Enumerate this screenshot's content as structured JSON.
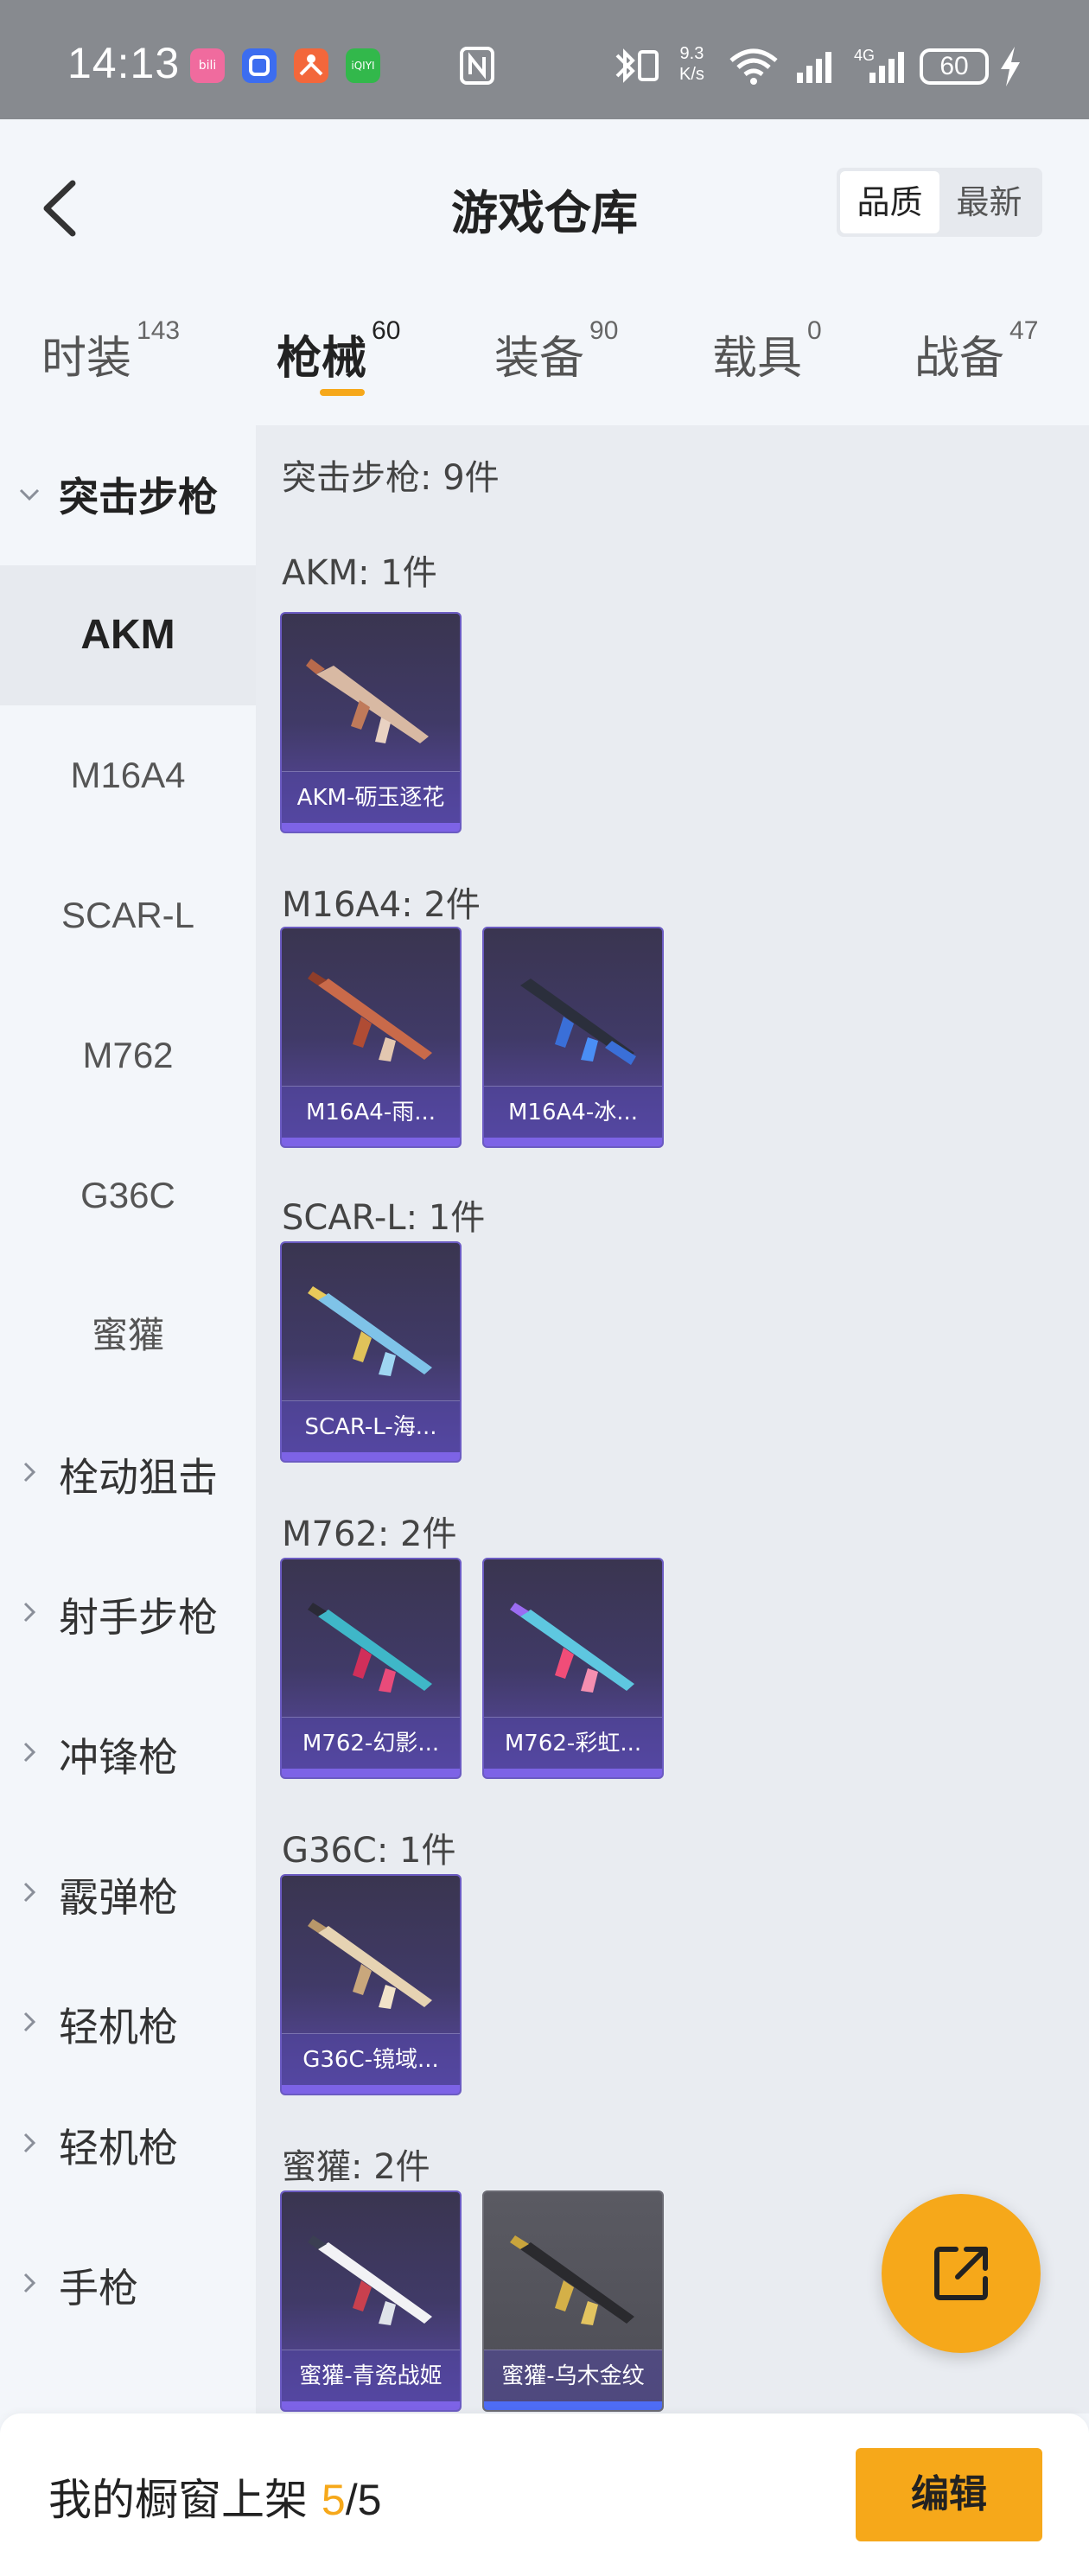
{
  "status_bar": {
    "time": "14:13",
    "apps": [
      {
        "name": "bilibili-app-icon",
        "label": "bili",
        "color": "#f06b9e"
      },
      {
        "name": "blue-app-icon",
        "label": "",
        "color": "#3c6df0"
      },
      {
        "name": "orange-app-icon",
        "label": "",
        "color": "#f3673b"
      },
      {
        "name": "iqiyi-app-icon",
        "label": "iQIYI",
        "color": "#32b84b"
      }
    ],
    "net_speed_value": "9.3",
    "net_speed_unit": "K/s",
    "battery": "60"
  },
  "header": {
    "title": "游戏仓库",
    "sort_options": [
      "品质",
      "最新"
    ],
    "active_sort": "品质"
  },
  "tabs": [
    {
      "label": "时装",
      "count": "143"
    },
    {
      "label": "枪械",
      "count": "60"
    },
    {
      "label": "装备",
      "count": "90"
    },
    {
      "label": "载具",
      "count": "0"
    },
    {
      "label": "战备",
      "count": "47"
    }
  ],
  "active_tab": "枪械",
  "sidebar": {
    "groups": [
      {
        "label": "突击步枪",
        "expanded": true
      },
      {
        "label": "栓动狙击",
        "expanded": false
      },
      {
        "label": "射手步枪",
        "expanded": false
      },
      {
        "label": "冲锋枪",
        "expanded": false
      },
      {
        "label": "霰弹枪",
        "expanded": false
      },
      {
        "label": "轻机枪",
        "expanded": false
      },
      {
        "label": "轻机枪",
        "expanded": false
      },
      {
        "label": "手枪",
        "expanded": false
      }
    ],
    "items": [
      "AKM",
      "M16A4",
      "SCAR-L",
      "M762",
      "G36C",
      "蜜獾"
    ],
    "active_item": "AKM"
  },
  "content": {
    "category_summary": "突击步枪: 9件",
    "sections": [
      {
        "label": "AKM: 1件",
        "cards": [
          {
            "name": "AKM-砺玉逐花",
            "style": "purple"
          }
        ]
      },
      {
        "label": "M16A4: 2件",
        "cards": [
          {
            "name": "M16A4-雨...",
            "style": "purple"
          },
          {
            "name": "M16A4-冰...",
            "style": "purple"
          }
        ]
      },
      {
        "label": "SCAR-L: 1件",
        "cards": [
          {
            "name": "SCAR-L-海...",
            "style": "purple"
          }
        ]
      },
      {
        "label": "M762: 2件",
        "cards": [
          {
            "name": "M762-幻影...",
            "style": "purple"
          },
          {
            "name": "M762-彩虹...",
            "style": "purple"
          }
        ]
      },
      {
        "label": "G36C: 1件",
        "cards": [
          {
            "name": "G36C-镜域...",
            "style": "purple"
          }
        ]
      },
      {
        "label": "蜜獾: 2件",
        "cards": [
          {
            "name": "蜜獾-青瓷战姬",
            "style": "purple"
          },
          {
            "name": "蜜獾-乌木金纹",
            "style": "grey"
          }
        ]
      }
    ]
  },
  "bottom_bar": {
    "showcase_label": "我的橱窗上架",
    "showcase_count": "5",
    "showcase_separator": "/",
    "showcase_total": "5",
    "edit_label": "编辑"
  },
  "colors": {
    "accent": "#f6a81a",
    "card_purple": "#403a67",
    "card_grey": "#4d4d55"
  }
}
